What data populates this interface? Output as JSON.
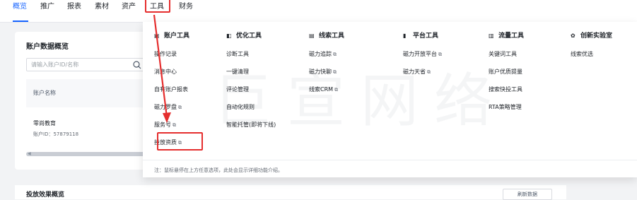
{
  "nav": {
    "tabs": [
      {
        "label": "概览"
      },
      {
        "label": "推广"
      },
      {
        "label": "报表"
      },
      {
        "label": "素材"
      },
      {
        "label": "资产"
      },
      {
        "label": "工具"
      },
      {
        "label": "财务"
      }
    ],
    "active_index": 0
  },
  "account_panel": {
    "title": "账户数据概览",
    "search_placeholder": "请输入账户ID/名称",
    "table_header": "账户名称",
    "account_name": "零尚教育",
    "account_id": "账户ID：57879118"
  },
  "bottom_panel": {
    "title": "投放效果概览",
    "button_label": "刷新数据"
  },
  "tools_menu": {
    "watermark": "巨宣网络",
    "columns": [
      {
        "title": "账户工具",
        "icon": "account-tools-icon",
        "items": [
          {
            "label": "操作记录",
            "external": false
          },
          {
            "label": "消息中心",
            "external": false
          },
          {
            "label": "自有账户报表",
            "external": false
          },
          {
            "label": "磁力罗盘",
            "external": true
          },
          {
            "label": "服务号",
            "external": true
          },
          {
            "label": "投放资质",
            "external": true
          }
        ]
      },
      {
        "title": "优化工具",
        "icon": "optimize-tools-icon",
        "items": [
          {
            "label": "诊断工具",
            "external": false
          },
          {
            "label": "一键清理",
            "external": false
          },
          {
            "label": "评论管理",
            "external": false
          },
          {
            "label": "自动化规则",
            "external": false
          },
          {
            "label": "智能托管(即将下线)",
            "external": false
          }
        ]
      },
      {
        "title": "线索工具",
        "icon": "lead-tools-icon",
        "items": [
          {
            "label": "磁力追踪",
            "external": true
          },
          {
            "label": "磁力快聊",
            "external": true
          },
          {
            "label": "线索CRM",
            "external": true
          }
        ]
      },
      {
        "title": "平台工具",
        "icon": "platform-tools-icon",
        "items": [
          {
            "label": "磁力开放平台",
            "external": true
          },
          {
            "label": "磁力天省",
            "external": true
          }
        ]
      },
      {
        "title": "流量工具",
        "icon": "traffic-tools-icon",
        "items": [
          {
            "label": "关键词工具",
            "external": false
          },
          {
            "label": "账户优质提量",
            "external": false
          },
          {
            "label": "搜索快投工具",
            "external": false
          },
          {
            "label": "RTA策略管理",
            "external": false
          }
        ]
      },
      {
        "title": "创新实验室",
        "icon": "innovation-lab-icon",
        "items": [
          {
            "label": "线索优选",
            "external": false
          }
        ]
      }
    ],
    "footer_note": "注：鼠标悬停在上方任意选项，此处会显示详细功能介绍。"
  },
  "colors": {
    "accent": "#1664ff",
    "highlight": "#e52e2e"
  }
}
